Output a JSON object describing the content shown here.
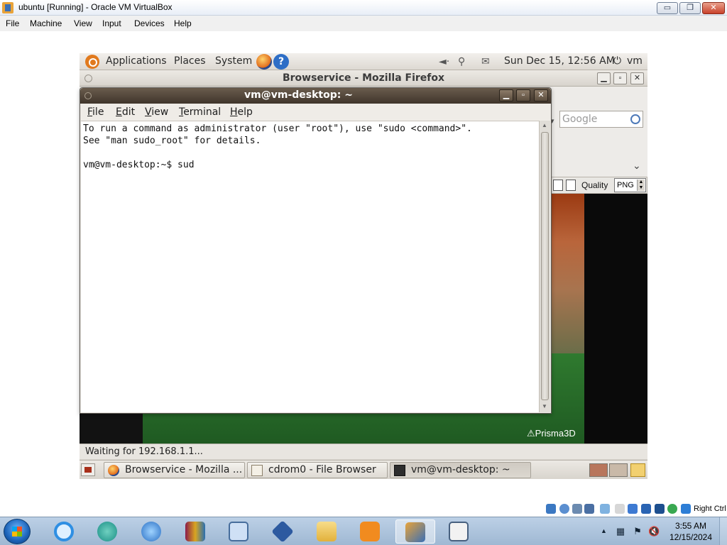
{
  "host_window": {
    "title": "ubuntu [Running] - Oracle VM VirtualBox",
    "minimize": "▭",
    "maximize": "❐",
    "close": "✕",
    "menu": [
      "File",
      "Machine",
      "View",
      "Input",
      "Devices",
      "Help"
    ]
  },
  "gnome_panel": {
    "applications": "Applications",
    "places": "Places",
    "system": "System",
    "help_glyph": "?",
    "clock": "Sun Dec 15, 12:56 AM",
    "user": "vm",
    "power_glyph": "⏻",
    "volume_glyph": "◄·",
    "network_glyph": "⚲",
    "mail_glyph": "✉"
  },
  "firefox": {
    "title": "Browservice - Mozilla Firefox",
    "search_placeholder": "Google",
    "quality_label": "Quality",
    "quality_value": "PNG",
    "watermark": "Prisma3D",
    "status": "Waiting for 192.168.1.1...",
    "minimize": "▁",
    "maximize": "▫",
    "close": "✕"
  },
  "terminal": {
    "title": "vm@vm-desktop: ~",
    "menu": [
      "File",
      "Edit",
      "View",
      "Terminal",
      "Help"
    ],
    "lines": [
      "To run a command as administrator (user \"root\"), use \"sudo <command>\".",
      "See \"man sudo_root\" for details.",
      "",
      "vm@vm-desktop:~$ sud"
    ],
    "minimize": "▁",
    "maximize": "▫",
    "close": "✕"
  },
  "guest_taskbar": {
    "tasks": [
      {
        "label": "Browservice - Mozilla ...",
        "icon": "firefox-icon"
      },
      {
        "label": "cdrom0 - File Browser",
        "icon": "folder-icon"
      },
      {
        "label": "vm@vm-desktop: ~",
        "icon": "terminal-icon"
      }
    ]
  },
  "host_status": {
    "host_key": "Right Ctrl"
  },
  "win_taskbar": {
    "pinned": [
      "internet-explorer-icon",
      "browser-icon",
      "download-manager-icon",
      "winrar-icon",
      "computer-icon",
      "virtualbox-icon",
      "file-explorer-icon",
      "media-player-icon",
      "app-icon",
      "window-icon"
    ],
    "clock_time": "3:55 AM",
    "clock_date": "12/15/2024",
    "tray_arrow": "▲"
  },
  "colors": {
    "ubuntu_orange": "#e17a1e",
    "terminal_title_brown": "#3f352b",
    "win7_taskbar": "#9fb8d3"
  }
}
